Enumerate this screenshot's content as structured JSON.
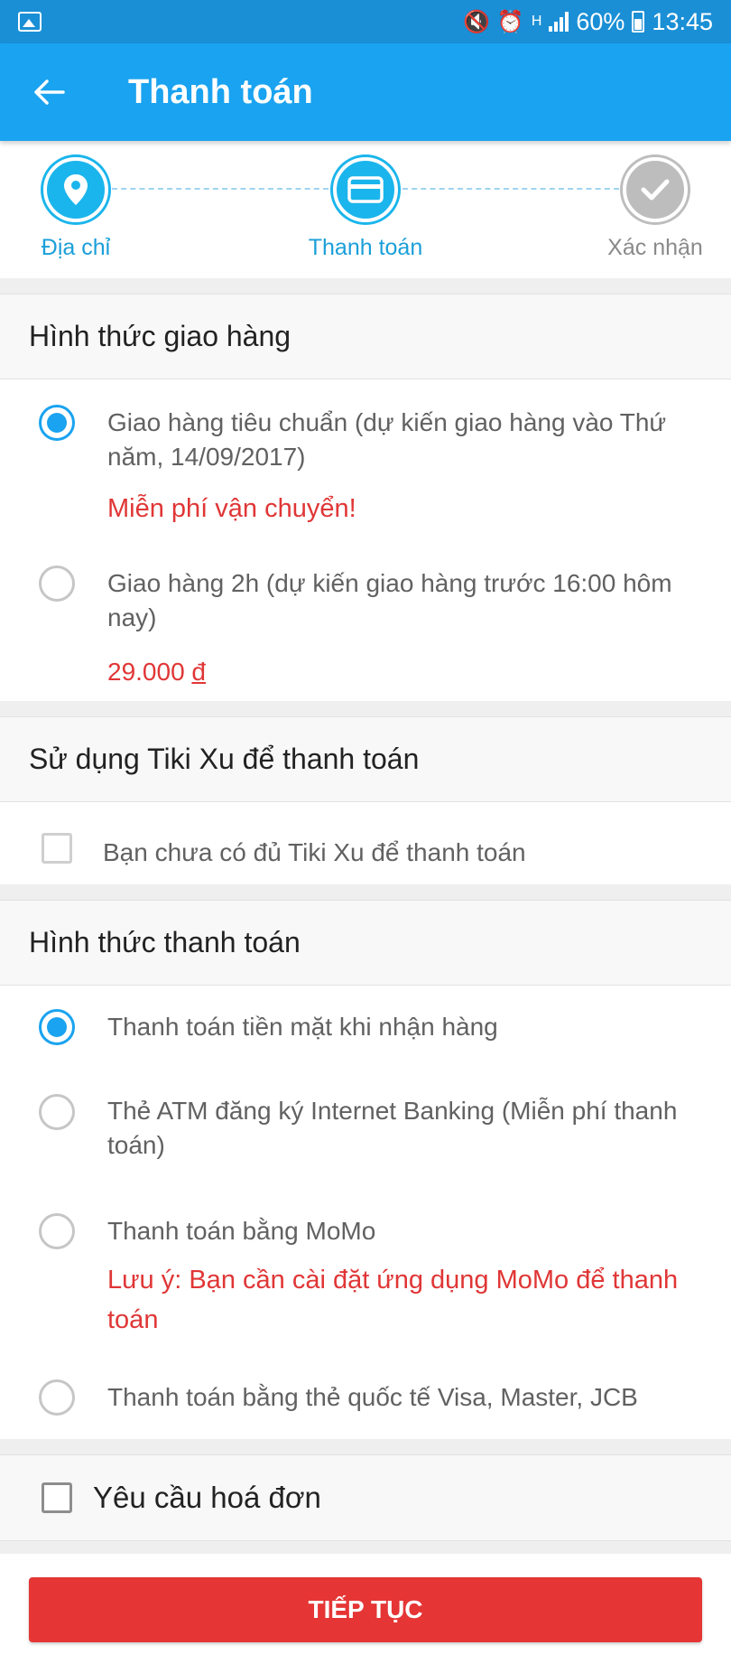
{
  "status_bar": {
    "battery": "60%",
    "time": "13:45",
    "network": "H"
  },
  "app_bar": {
    "title": "Thanh toán"
  },
  "stepper": {
    "steps": [
      {
        "label": "Địa chỉ",
        "state": "done",
        "icon": "location-pin-icon"
      },
      {
        "label": "Thanh toán",
        "state": "current",
        "icon": "credit-card-icon"
      },
      {
        "label": "Xác nhận",
        "state": "pending",
        "icon": "checkmark-icon"
      }
    ]
  },
  "delivery": {
    "title": "Hình thức giao hàng",
    "options": [
      {
        "label": "Giao hàng tiêu chuẩn (dự kiến giao hàng vào Thứ năm, 14/09/2017)",
        "note": "Miễn phí vận chuyển!",
        "selected": true
      },
      {
        "label": "Giao hàng 2h (dự kiến giao hàng trước 16:00 hôm nay)",
        "price": "29.000",
        "currency": "đ",
        "selected": false
      }
    ]
  },
  "tiki_xu": {
    "title": "Sử dụng Tiki Xu để thanh toán",
    "checkbox_label": "Bạn chưa có đủ Tiki Xu để thanh toán",
    "enabled": false
  },
  "payment": {
    "title": "Hình thức thanh toán",
    "options": [
      {
        "label": "Thanh toán tiền mặt khi nhận hàng",
        "selected": true
      },
      {
        "label": "Thẻ ATM đăng ký Internet Banking (Miễn phí thanh toán)",
        "selected": false
      },
      {
        "label": "Thanh toán bằng MoMo",
        "note": "Lưu ý: Bạn cần cài đặt ứng dụng MoMo để thanh toán",
        "selected": false
      },
      {
        "label": "Thanh toán bằng thẻ quốc tế Visa, Master, JCB",
        "selected": false
      }
    ]
  },
  "invoice": {
    "label": "Yêu cầu hoá đơn",
    "checked": false
  },
  "continue_button": "TIẾP TỤC",
  "colors": {
    "primary": "#1aa3f0",
    "status_bar": "#1a8fd6",
    "accent_red": "#e53535"
  }
}
